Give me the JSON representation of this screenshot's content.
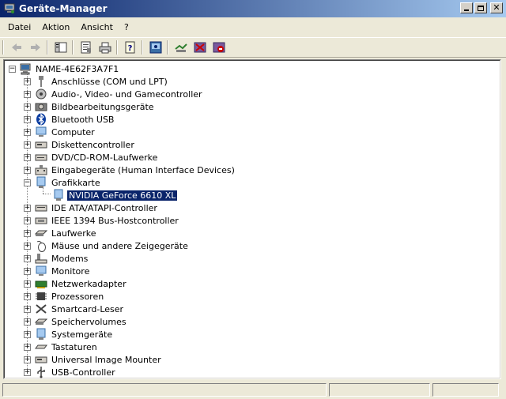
{
  "window": {
    "title": "Geräte-Manager"
  },
  "menubar": {
    "items": [
      "Datei",
      "Aktion",
      "Ansicht",
      "?"
    ]
  },
  "tree": {
    "root_label": "NAME-4E62F3A7F1",
    "items": [
      {
        "label": "Anschlüsse (COM und LPT)",
        "icon": "port-icon",
        "expanded": false
      },
      {
        "label": "Audio-, Video- und Gamecontroller",
        "icon": "audio-icon",
        "expanded": false
      },
      {
        "label": "Bildbearbeitungsgeräte",
        "icon": "camera-icon",
        "expanded": false
      },
      {
        "label": "Bluetooth USB",
        "icon": "bluetooth-icon",
        "expanded": false
      },
      {
        "label": "Computer",
        "icon": "computer-icon",
        "expanded": false
      },
      {
        "label": "Diskettencontroller",
        "icon": "floppy-controller-icon",
        "expanded": false
      },
      {
        "label": "DVD/CD-ROM-Laufwerke",
        "icon": "cdrom-icon",
        "expanded": false
      },
      {
        "label": "Eingabegeräte (Human Interface Devices)",
        "icon": "hid-icon",
        "expanded": false
      },
      {
        "label": "Grafikkarte",
        "icon": "display-adapter-icon",
        "expanded": true,
        "children": [
          {
            "label": "NVIDIA GeForce 6610 XL",
            "icon": "display-adapter-icon",
            "selected": true
          }
        ]
      },
      {
        "label": "IDE ATA/ATAPI-Controller",
        "icon": "ide-icon",
        "expanded": false
      },
      {
        "label": "IEEE 1394 Bus-Hostcontroller",
        "icon": "firewire-icon",
        "expanded": false
      },
      {
        "label": "Laufwerke",
        "icon": "disk-drive-icon",
        "expanded": false
      },
      {
        "label": "Mäuse und andere Zeigegeräte",
        "icon": "mouse-icon",
        "expanded": false
      },
      {
        "label": "Modems",
        "icon": "modem-icon",
        "expanded": false
      },
      {
        "label": "Monitore",
        "icon": "monitor-icon",
        "expanded": false
      },
      {
        "label": "Netzwerkadapter",
        "icon": "network-adapter-icon",
        "expanded": false
      },
      {
        "label": "Prozessoren",
        "icon": "processor-icon",
        "expanded": false
      },
      {
        "label": "Smartcard-Leser",
        "icon": "smartcard-icon",
        "expanded": false
      },
      {
        "label": "Speichervolumes",
        "icon": "storage-volume-icon",
        "expanded": false
      },
      {
        "label": "Systemgeräte",
        "icon": "system-device-icon",
        "expanded": false
      },
      {
        "label": "Tastaturen",
        "icon": "keyboard-icon",
        "expanded": false
      },
      {
        "label": "Universal Image Mounter",
        "icon": "image-mounter-icon",
        "expanded": false
      },
      {
        "label": "USB-Controller",
        "icon": "usb-icon",
        "expanded": false
      }
    ]
  },
  "toolbar": {
    "buttons": [
      "back-arrow-icon",
      "forward-arrow-icon",
      "show-hide-tree-icon",
      "properties-icon",
      "print-icon",
      "help-icon",
      "scan-hardware-icon",
      "update-driver-icon",
      "disable-device-icon",
      "uninstall-device-icon"
    ]
  },
  "colors": {
    "selection": "#0a246a",
    "titlebar_start": "#0a246a",
    "titlebar_end": "#a6caf0",
    "face": "#ece9d8"
  }
}
